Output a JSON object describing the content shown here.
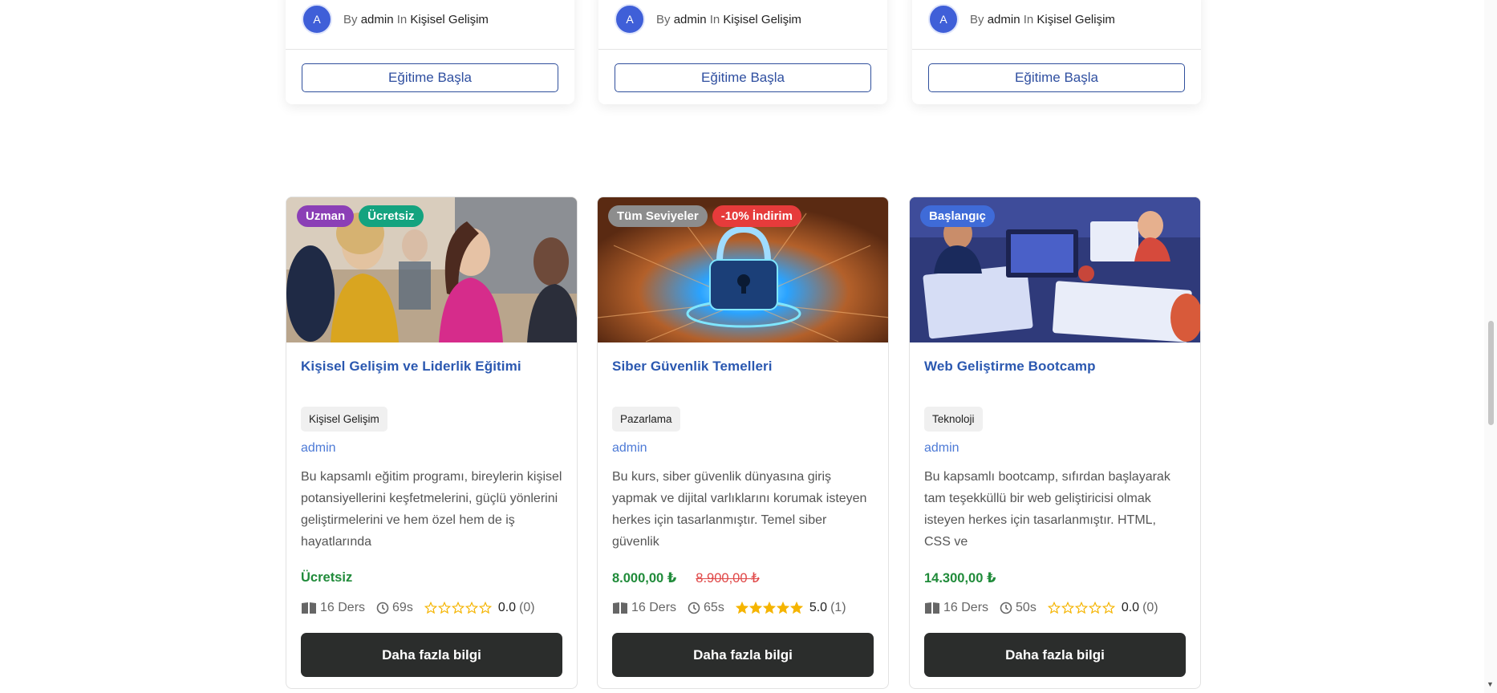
{
  "top_cards": [
    {
      "avatar": "A",
      "by": "By",
      "author": "admin",
      "in": "In",
      "category": "Kişisel Gelişim",
      "button": "Eğitime Başla"
    },
    {
      "avatar": "A",
      "by": "By",
      "author": "admin",
      "in": "In",
      "category": "Kişisel Gelişim",
      "button": "Eğitime Başla"
    },
    {
      "avatar": "A",
      "by": "By",
      "author": "admin",
      "in": "In",
      "category": "Kişisel Gelişim",
      "button": "Eğitime Başla"
    }
  ],
  "courses": [
    {
      "badges": [
        {
          "label": "Uzman",
          "color": "#8b3fb6"
        },
        {
          "label": "Ücretsiz",
          "color": "#14a37f"
        }
      ],
      "title": "Kişisel Gelişim ve Liderlik Eğitimi",
      "category": "Kişisel Gelişim",
      "author": "admin",
      "description": "Bu kapsamlı eğitim programı, bireylerin kişisel potansiyellerini keşfetmelerini, güçlü yönlerini geliştirmelerini ve hem özel hem de iş hayatlarında",
      "price": "Ücretsiz",
      "old_price": "",
      "lessons": "16 Ders",
      "duration": "69s",
      "rating": 0,
      "rating_text": "0.0",
      "rating_count": "(0)",
      "button": "Daha fazla bilgi"
    },
    {
      "badges": [
        {
          "label": "Tüm Seviyeler",
          "color": "#8d8d8d"
        },
        {
          "label": "-10% İndirim",
          "color": "#e63b3b"
        }
      ],
      "title": "Siber Güvenlik Temelleri",
      "category": "Pazarlama",
      "author": "admin",
      "description": "Bu kurs, siber güvenlik dünyasına giriş yapmak ve dijital varlıklarını korumak isteyen herkes için tasarlanmıştır. Temel siber güvenlik",
      "price": "8.000,00 ₺",
      "old_price": "8.900,00 ₺",
      "lessons": "16 Ders",
      "duration": "65s",
      "rating": 5,
      "rating_text": "5.0",
      "rating_count": "(1)",
      "button": "Daha fazla bilgi"
    },
    {
      "badges": [
        {
          "label": "Başlangıç",
          "color": "#3f6bd8"
        }
      ],
      "title": "Web Geliştirme Bootcamp",
      "category": "Teknoloji",
      "author": "admin",
      "description": "Bu kapsamlı bootcamp, sıfırdan başlayarak tam teşekküllü bir web geliştiricisi olmak isteyen herkes için tasarlanmıştır. HTML, CSS ve",
      "price": "14.300,00 ₺",
      "old_price": "",
      "lessons": "16 Ders",
      "duration": "50s",
      "rating": 0,
      "rating_text": "0.0",
      "rating_count": "(0)",
      "button": "Daha fazla bilgi"
    }
  ],
  "icons": {
    "lessons": "book-icon",
    "duration": "clock-icon",
    "rating": "star-icon",
    "avatar": "avatar"
  },
  "colors": {
    "star_filled": "#f5b400",
    "star_empty": "#f5b400",
    "title": "#2b58b0",
    "price": "#208b3a",
    "old_price": "#e04848"
  }
}
